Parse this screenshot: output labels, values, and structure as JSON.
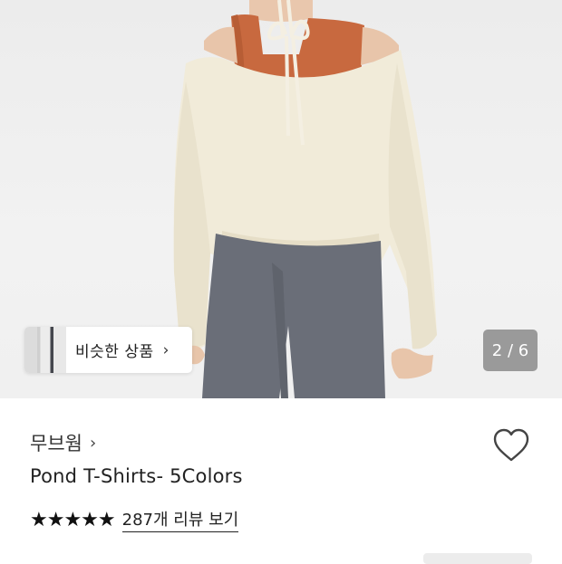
{
  "image_counter": "2 / 6",
  "similar_products": {
    "label": "비슷한 상품",
    "chevron": "›"
  },
  "product": {
    "brand": "무브웜",
    "brand_chevron": "›",
    "title": "Pond T-Shirts- 5Colors",
    "rating_stars": "★★★★★",
    "rating_value": 5,
    "reviews_link": "287개 리뷰 보기"
  },
  "colors": {
    "sweater": "#f1ebd9",
    "tank": "#c8693f",
    "pants": "#6a6e78",
    "counter_bg": "#7a7a7a"
  },
  "icons": [
    "chevron-right-icon",
    "heart-icon",
    "star-icon"
  ]
}
